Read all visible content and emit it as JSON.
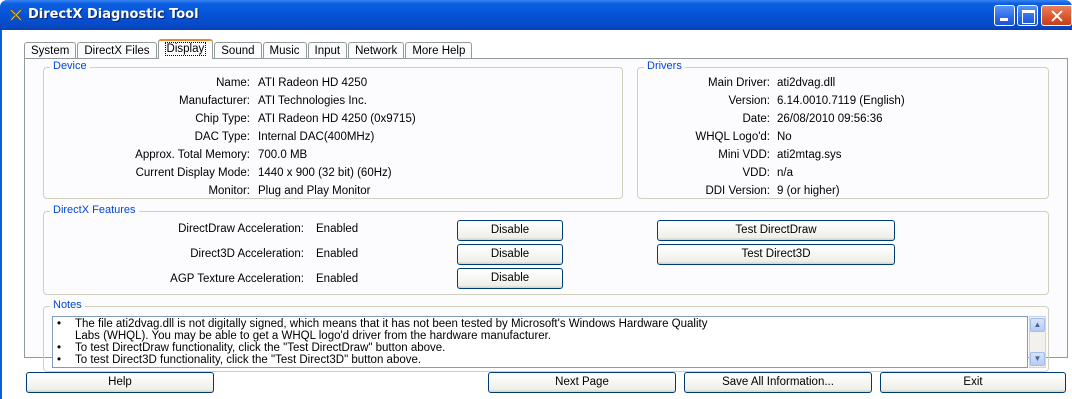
{
  "window": {
    "title": "DirectX Diagnostic Tool"
  },
  "tabs": [
    {
      "label": "System",
      "active": false
    },
    {
      "label": "DirectX Files",
      "active": false
    },
    {
      "label": "Display",
      "active": true
    },
    {
      "label": "Sound",
      "active": false
    },
    {
      "label": "Music",
      "active": false
    },
    {
      "label": "Input",
      "active": false
    },
    {
      "label": "Network",
      "active": false
    },
    {
      "label": "More Help",
      "active": false
    }
  ],
  "device": {
    "legend": "Device",
    "fields": [
      {
        "label": "Name:",
        "value": "ATI Radeon HD 4250"
      },
      {
        "label": "Manufacturer:",
        "value": "ATI Technologies Inc."
      },
      {
        "label": "Chip Type:",
        "value": "ATI Radeon HD 4250 (0x9715)"
      },
      {
        "label": "DAC Type:",
        "value": "Internal DAC(400MHz)"
      },
      {
        "label": "Approx. Total Memory:",
        "value": "700.0 MB"
      },
      {
        "label": "Current Display Mode:",
        "value": "1440 x 900 (32 bit) (60Hz)"
      },
      {
        "label": "Monitor:",
        "value": "Plug and Play Monitor"
      }
    ]
  },
  "drivers": {
    "legend": "Drivers",
    "fields": [
      {
        "label": "Main Driver:",
        "value": "ati2dvag.dll"
      },
      {
        "label": "Version:",
        "value": "6.14.0010.7119 (English)"
      },
      {
        "label": "Date:",
        "value": "26/08/2010 09:56:36"
      },
      {
        "label": "WHQL Logo'd:",
        "value": "No"
      },
      {
        "label": "Mini VDD:",
        "value": "ati2mtag.sys"
      },
      {
        "label": "VDD:",
        "value": "n/a"
      },
      {
        "label": "DDI Version:",
        "value": "9 (or higher)"
      }
    ]
  },
  "features": {
    "legend": "DirectX Features",
    "rows": [
      {
        "label": "DirectDraw Acceleration:",
        "value": "Enabled",
        "disable_label": "Disable",
        "test_label": "Test DirectDraw"
      },
      {
        "label": "Direct3D Acceleration:",
        "value": "Enabled",
        "disable_label": "Disable",
        "test_label": "Test Direct3D"
      },
      {
        "label": "AGP Texture Acceleration:",
        "value": "Enabled",
        "disable_label": "Disable",
        "test_label": ""
      }
    ]
  },
  "notes": {
    "legend": "Notes",
    "items": [
      {
        "bullet": "•",
        "text": "The file ati2dvag.dll is not digitally signed, which means that it has not been tested by Microsoft's Windows Hardware Quality",
        "continuation": "Labs (WHQL).  You may be able to get a WHQL logo'd driver from the hardware manufacturer."
      },
      {
        "bullet": "•",
        "text": "To test DirectDraw functionality, click the \"Test DirectDraw\" button above."
      },
      {
        "bullet": "•",
        "text": "To test Direct3D functionality, click the \"Test Direct3D\" button above."
      }
    ]
  },
  "bottom_buttons": {
    "help": "Help",
    "next_page": "Next Page",
    "save_all": "Save All Information...",
    "exit": "Exit"
  },
  "colors": {
    "titlebar": "#0553d6",
    "group_legend": "#0046d5",
    "active_tab_accent": "#e68b2c"
  }
}
